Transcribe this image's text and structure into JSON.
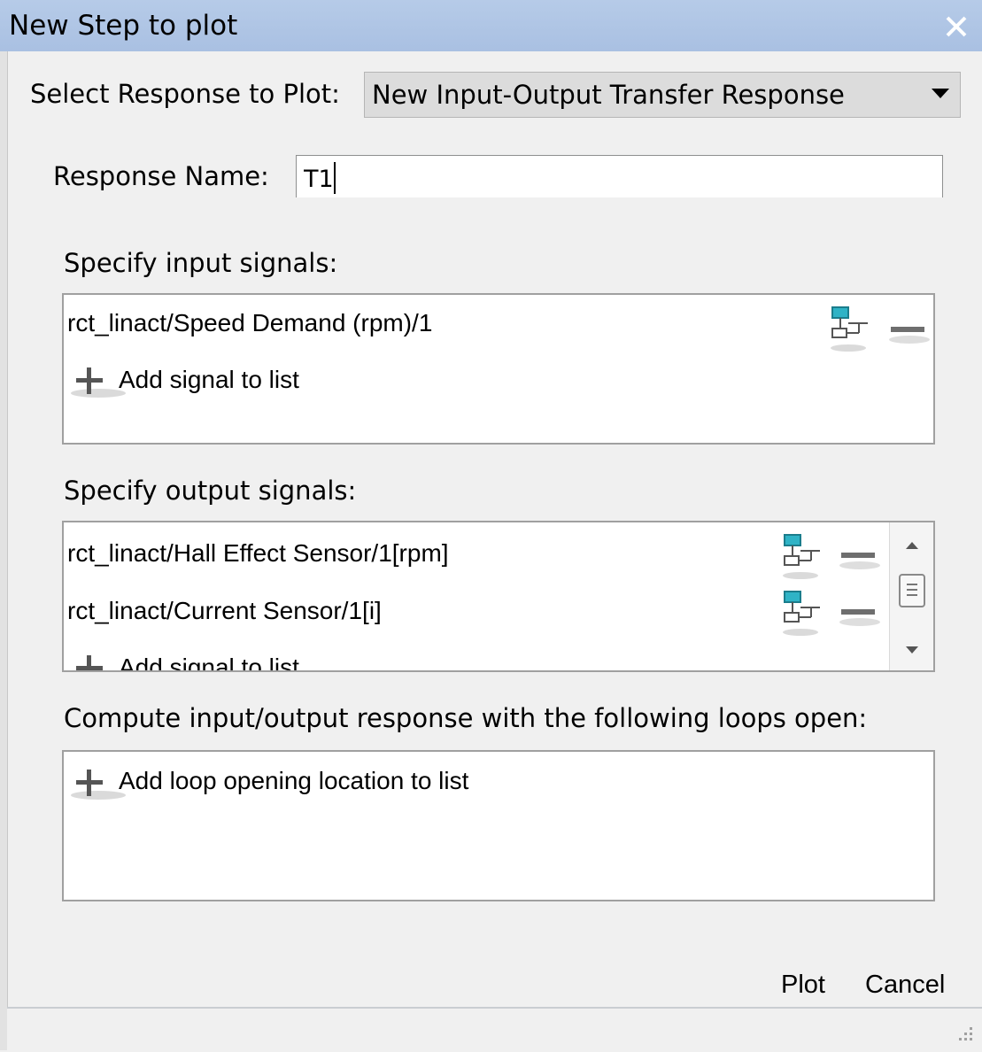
{
  "window": {
    "title": "New Step to plot",
    "close_icon": "close-icon"
  },
  "response_select": {
    "label": "Select Response to Plot:",
    "selected": "New Input-Output Transfer Response"
  },
  "response_name": {
    "label": "Response Name:",
    "value": "T1"
  },
  "inputs": {
    "heading": "Specify input signals:",
    "items": [
      {
        "label": "rct_linact/Speed Demand (rpm)/1"
      }
    ],
    "add_label": "Add signal to list"
  },
  "outputs": {
    "heading": "Specify output signals:",
    "items": [
      {
        "label": "rct_linact/Hall Effect Sensor/1[rpm]"
      },
      {
        "label": "rct_linact/Current Sensor/1[i]"
      }
    ],
    "add_label": "Add signal to list"
  },
  "loops": {
    "heading": "Compute input/output response with the following loops open:",
    "add_label": "Add loop opening location to list"
  },
  "buttons": {
    "plot": "Plot",
    "cancel": "Cancel"
  },
  "colors": {
    "title_bar": "#b6cbe8",
    "dialog_bg": "#f0f0f0",
    "signal_icon": "#2fb3c6"
  }
}
